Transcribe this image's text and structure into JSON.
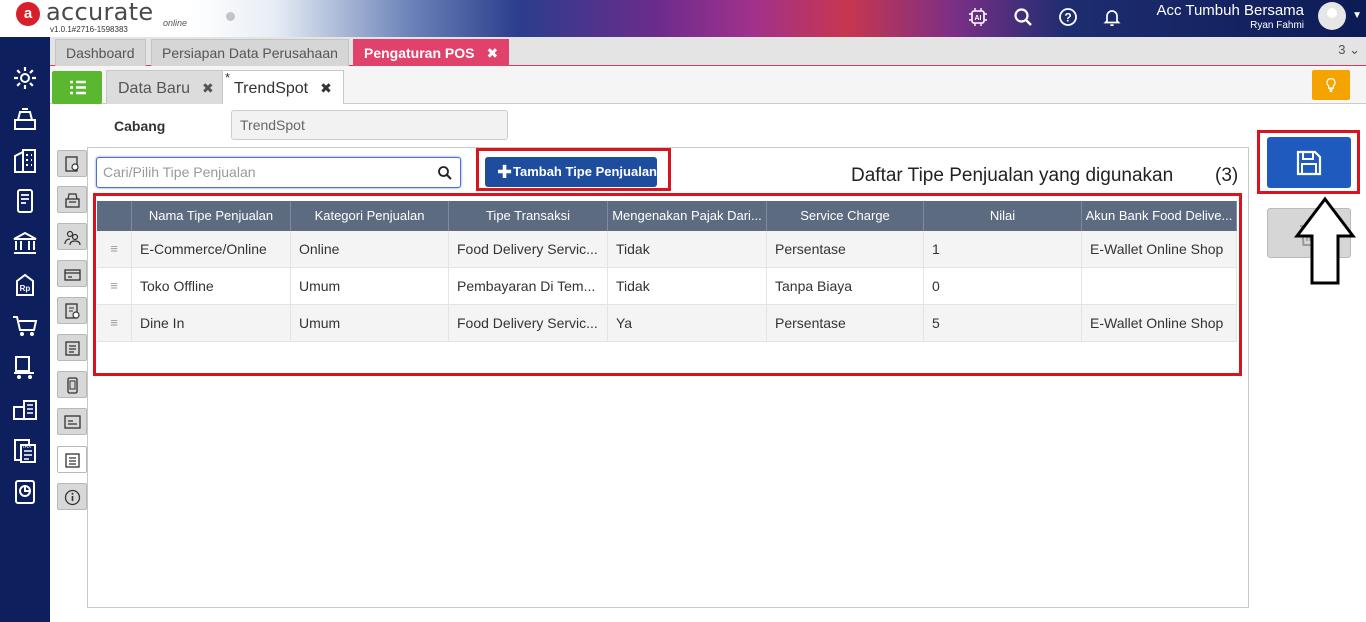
{
  "app": {
    "brand": "accurate",
    "brand_sub": "online",
    "version": "v1.0.1#2716-1598383",
    "company": "Acc Tumbuh Bersama",
    "user": "Ryan Fahmi"
  },
  "top_tabs": [
    {
      "label": "Dashboard"
    },
    {
      "label": "Persiapan Data Perusahaan"
    },
    {
      "label": "Pengaturan POS",
      "close": "✖"
    }
  ],
  "tab_count": "3",
  "sub_tabs": [
    {
      "label": "Data Baru",
      "close": "✖"
    },
    {
      "label": "TrendSpot",
      "close": "✖",
      "modified": "*"
    }
  ],
  "form": {
    "cabang_label": "Cabang",
    "cabang_value": "TrendSpot"
  },
  "search": {
    "placeholder": "Cari/Pilih Tipe Penjualan"
  },
  "add_button": {
    "label": "Tambah Tipe Penjualan"
  },
  "list": {
    "title": "Daftar Tipe Penjualan yang digunakan",
    "count": "(3)"
  },
  "table": {
    "columns": [
      "Nama Tipe Penjualan",
      "Kategori Penjualan",
      "Tipe Transaksi",
      "Mengenakan Pajak Dari...",
      "Service Charge",
      "Nilai",
      "Akun Bank Food Delive..."
    ],
    "rows": [
      [
        "E-Commerce/Online",
        "Online",
        "Food Delivery Servic...",
        "Tidak",
        "Persentase",
        "1",
        "E-Wallet Online Shop"
      ],
      [
        "Toko Offline",
        "Umum",
        "Pembayaran Di Tem...",
        "Tidak",
        "Tanpa Biaya",
        "0",
        ""
      ],
      [
        "Dine In",
        "Umum",
        "Food Delivery Servic...",
        "Ya",
        "Persentase",
        "5",
        "E-Wallet Online Shop"
      ]
    ],
    "drag_glyph": "≡"
  },
  "colors": {
    "nav_bg": "#0d1f5c",
    "active_tab": "#e0426b",
    "menu_green": "#5bb630",
    "primary_blue": "#1f4d9e",
    "highlight_red": "#d9141e",
    "bulb_orange": "#f5a300"
  }
}
